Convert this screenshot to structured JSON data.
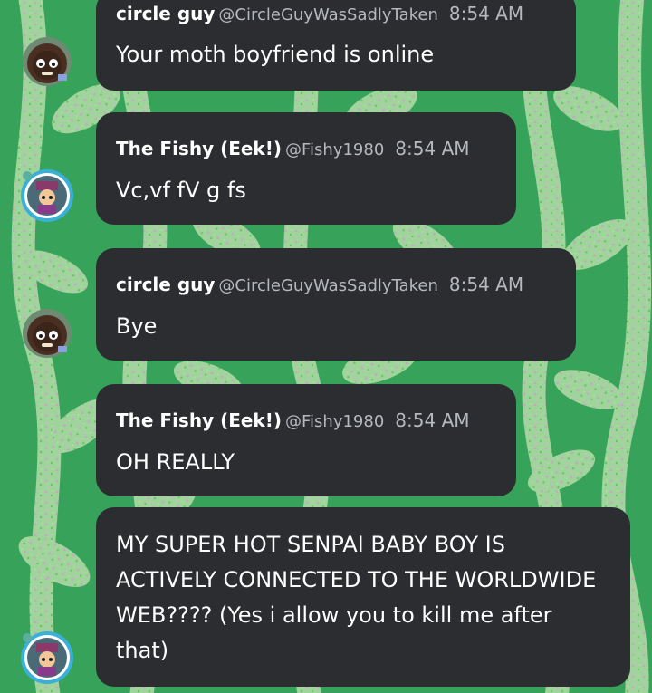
{
  "messages": [
    {
      "name": "circle guy",
      "handle": "@CircleGuyWasSadlyTaken",
      "time": "8:54 AM",
      "text": "Your moth boyfriend is online",
      "avatar": "circle-guy-avatar"
    },
    {
      "name": "The Fishy (Eek!)",
      "handle": "@Fishy1980",
      "time": "8:54 AM",
      "text": "Vc,vf fV g fs",
      "avatar": "fishy-avatar"
    },
    {
      "name": "circle guy",
      "handle": "@CircleGuyWasSadlyTaken",
      "time": "8:54 AM",
      "text": "Bye",
      "avatar": "circle-guy-avatar"
    },
    {
      "name": "The Fishy (Eek!)",
      "handle": "@Fishy1980",
      "time": "8:54 AM",
      "text": "OH REALLY",
      "avatar": "fishy-avatar"
    },
    {
      "text": "MY SUPER HOT SENPAI BABY BOY IS ACTIVELY CONNECTED TO THE WORLDWIDE WEB???? (Yes i allow you to kill me after that)",
      "avatar": "fishy-avatar"
    }
  ],
  "colors": {
    "bubble": "#2b2d31",
    "background": "#3aa85c",
    "vine": "#8fd18f",
    "meta_text": "#b5b8bd"
  }
}
